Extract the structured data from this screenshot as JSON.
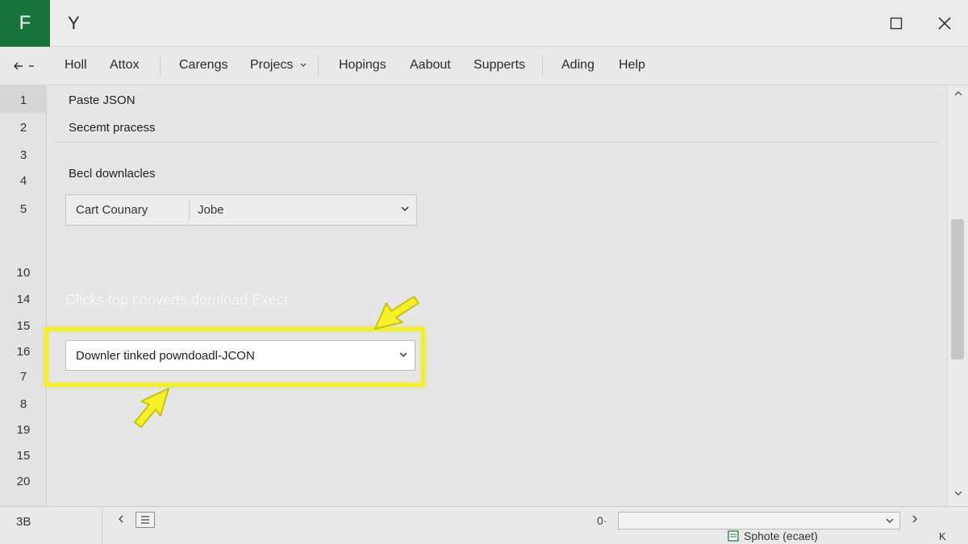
{
  "window": {
    "app_letter": "F",
    "title": "Y",
    "accent_color": "#17743b"
  },
  "menu": {
    "back_icon": "back-arrow-icon",
    "items": [
      {
        "label": "Holl"
      },
      {
        "label": "Attox"
      },
      {
        "label": "Carengs"
      },
      {
        "label": "Projecs"
      },
      {
        "label": "Hopings"
      },
      {
        "label": "Aabout"
      },
      {
        "label": "Supperts"
      },
      {
        "label": "Ading"
      },
      {
        "label": "Help"
      }
    ]
  },
  "rows": {
    "numbers": [
      "1",
      "2",
      "3",
      "4",
      "5",
      "10",
      "14",
      "15",
      "16",
      "7",
      "8",
      "19",
      "15",
      "20"
    ]
  },
  "content": {
    "line1": "Paste JSON",
    "line2": "Secemt pracess",
    "section_label": "Becl downlacles",
    "select": {
      "label": "Cart Counary",
      "value": "Jobe"
    },
    "hint": "Clicks top converts dornload Exect",
    "json_dropdown": {
      "value": "Downler tinked powndoadl-JCON"
    },
    "highlight_color": "#f3f02a"
  },
  "statusbar": {
    "cell_ref": "3B",
    "status_text": "Sphote (ecaet)",
    "corner_text": "K",
    "zoom_icon_text": "0·"
  }
}
